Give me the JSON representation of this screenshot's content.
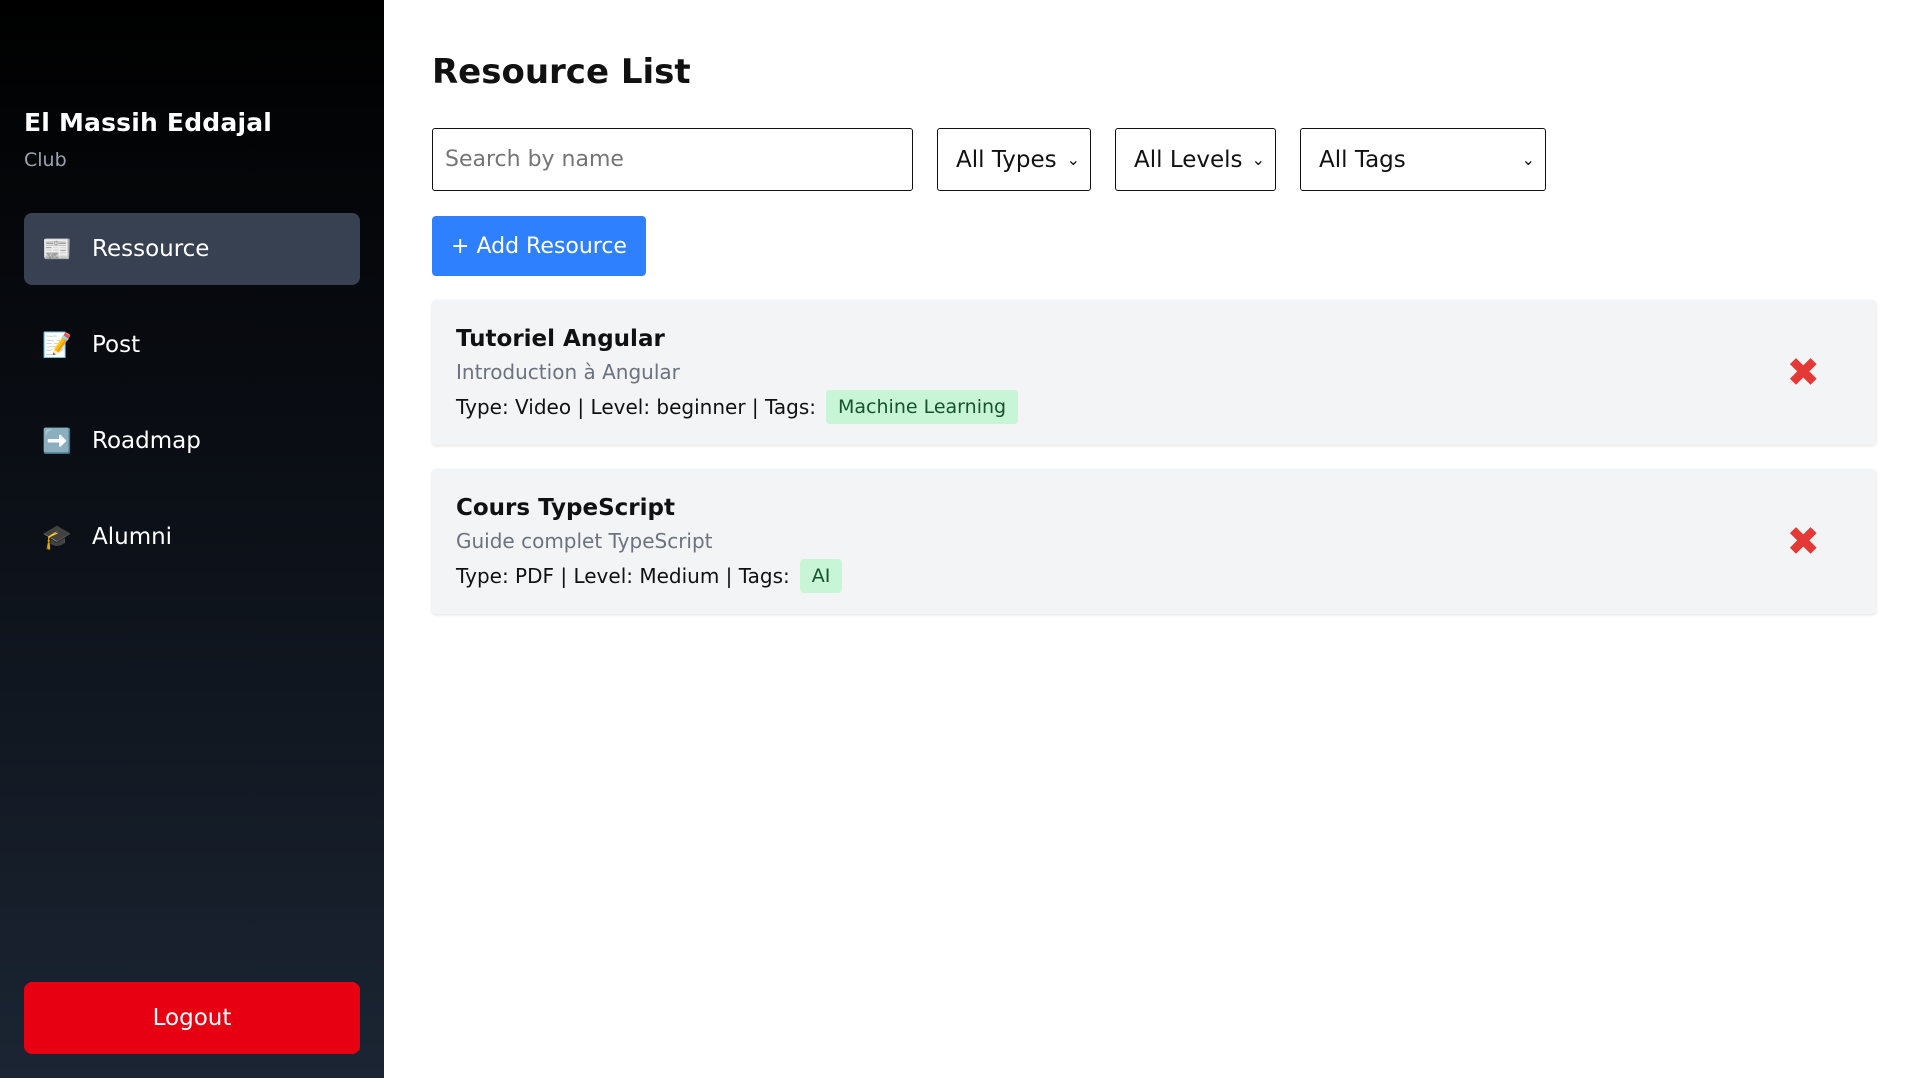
{
  "sidebar": {
    "brand_name": "El Massih Eddajal",
    "brand_sub": "Club",
    "items": [
      {
        "label": "Ressource",
        "icon": "📰",
        "icon_name": "newspaper-icon",
        "active": true
      },
      {
        "label": "Post",
        "icon": "📝",
        "icon_name": "memo-icon",
        "active": false
      },
      {
        "label": "Roadmap",
        "icon": "➡️",
        "icon_name": "arrow-right-icon",
        "active": false
      },
      {
        "label": "Alumni",
        "icon": "🎓",
        "icon_name": "graduation-cap-icon",
        "active": false
      }
    ],
    "logout_label": "Logout"
  },
  "main": {
    "title": "Resource List",
    "search_placeholder": "Search by name",
    "filters": {
      "type": "All Types",
      "level": "All Levels",
      "tags": "All Tags"
    },
    "add_label": "+ Add Resource",
    "resources": [
      {
        "title": "Tutoriel Angular",
        "description": "Introduction à Angular",
        "meta": "Type: Video | Level: beginner | Tags:",
        "tag": "Machine Learning"
      },
      {
        "title": "Cours TypeScript",
        "description": "Guide complet TypeScript",
        "meta": "Type: PDF | Level: Medium | Tags:",
        "tag": "AI"
      }
    ],
    "delete_icon": "✖"
  },
  "colors": {
    "accent": "#2f80ff",
    "logout": "#e60012",
    "delete": "#e53935",
    "tag_bg": "#c8f5d6",
    "active_nav": "#374151"
  }
}
